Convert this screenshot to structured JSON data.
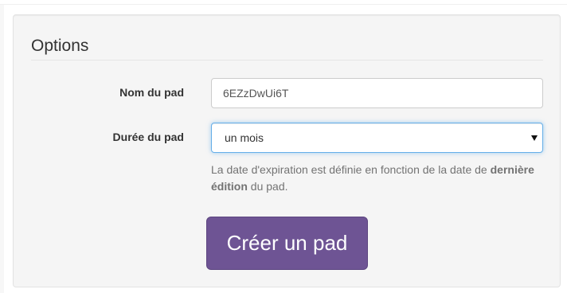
{
  "options": {
    "title": "Options",
    "pad_name": {
      "label": "Nom du pad",
      "value": "6EZzDwUi6T"
    },
    "pad_duration": {
      "label": "Durée du pad",
      "selected": "un mois"
    },
    "help": {
      "text_before": "La date d'expiration est définie en fonction de la date de ",
      "text_bold": "dernière édition",
      "text_after": " du pad."
    },
    "create_button": "Créer un pad"
  },
  "colors": {
    "button_bg": "#6e5494",
    "focus_border": "#66afe9",
    "panel_bg": "#f5f5f5"
  }
}
